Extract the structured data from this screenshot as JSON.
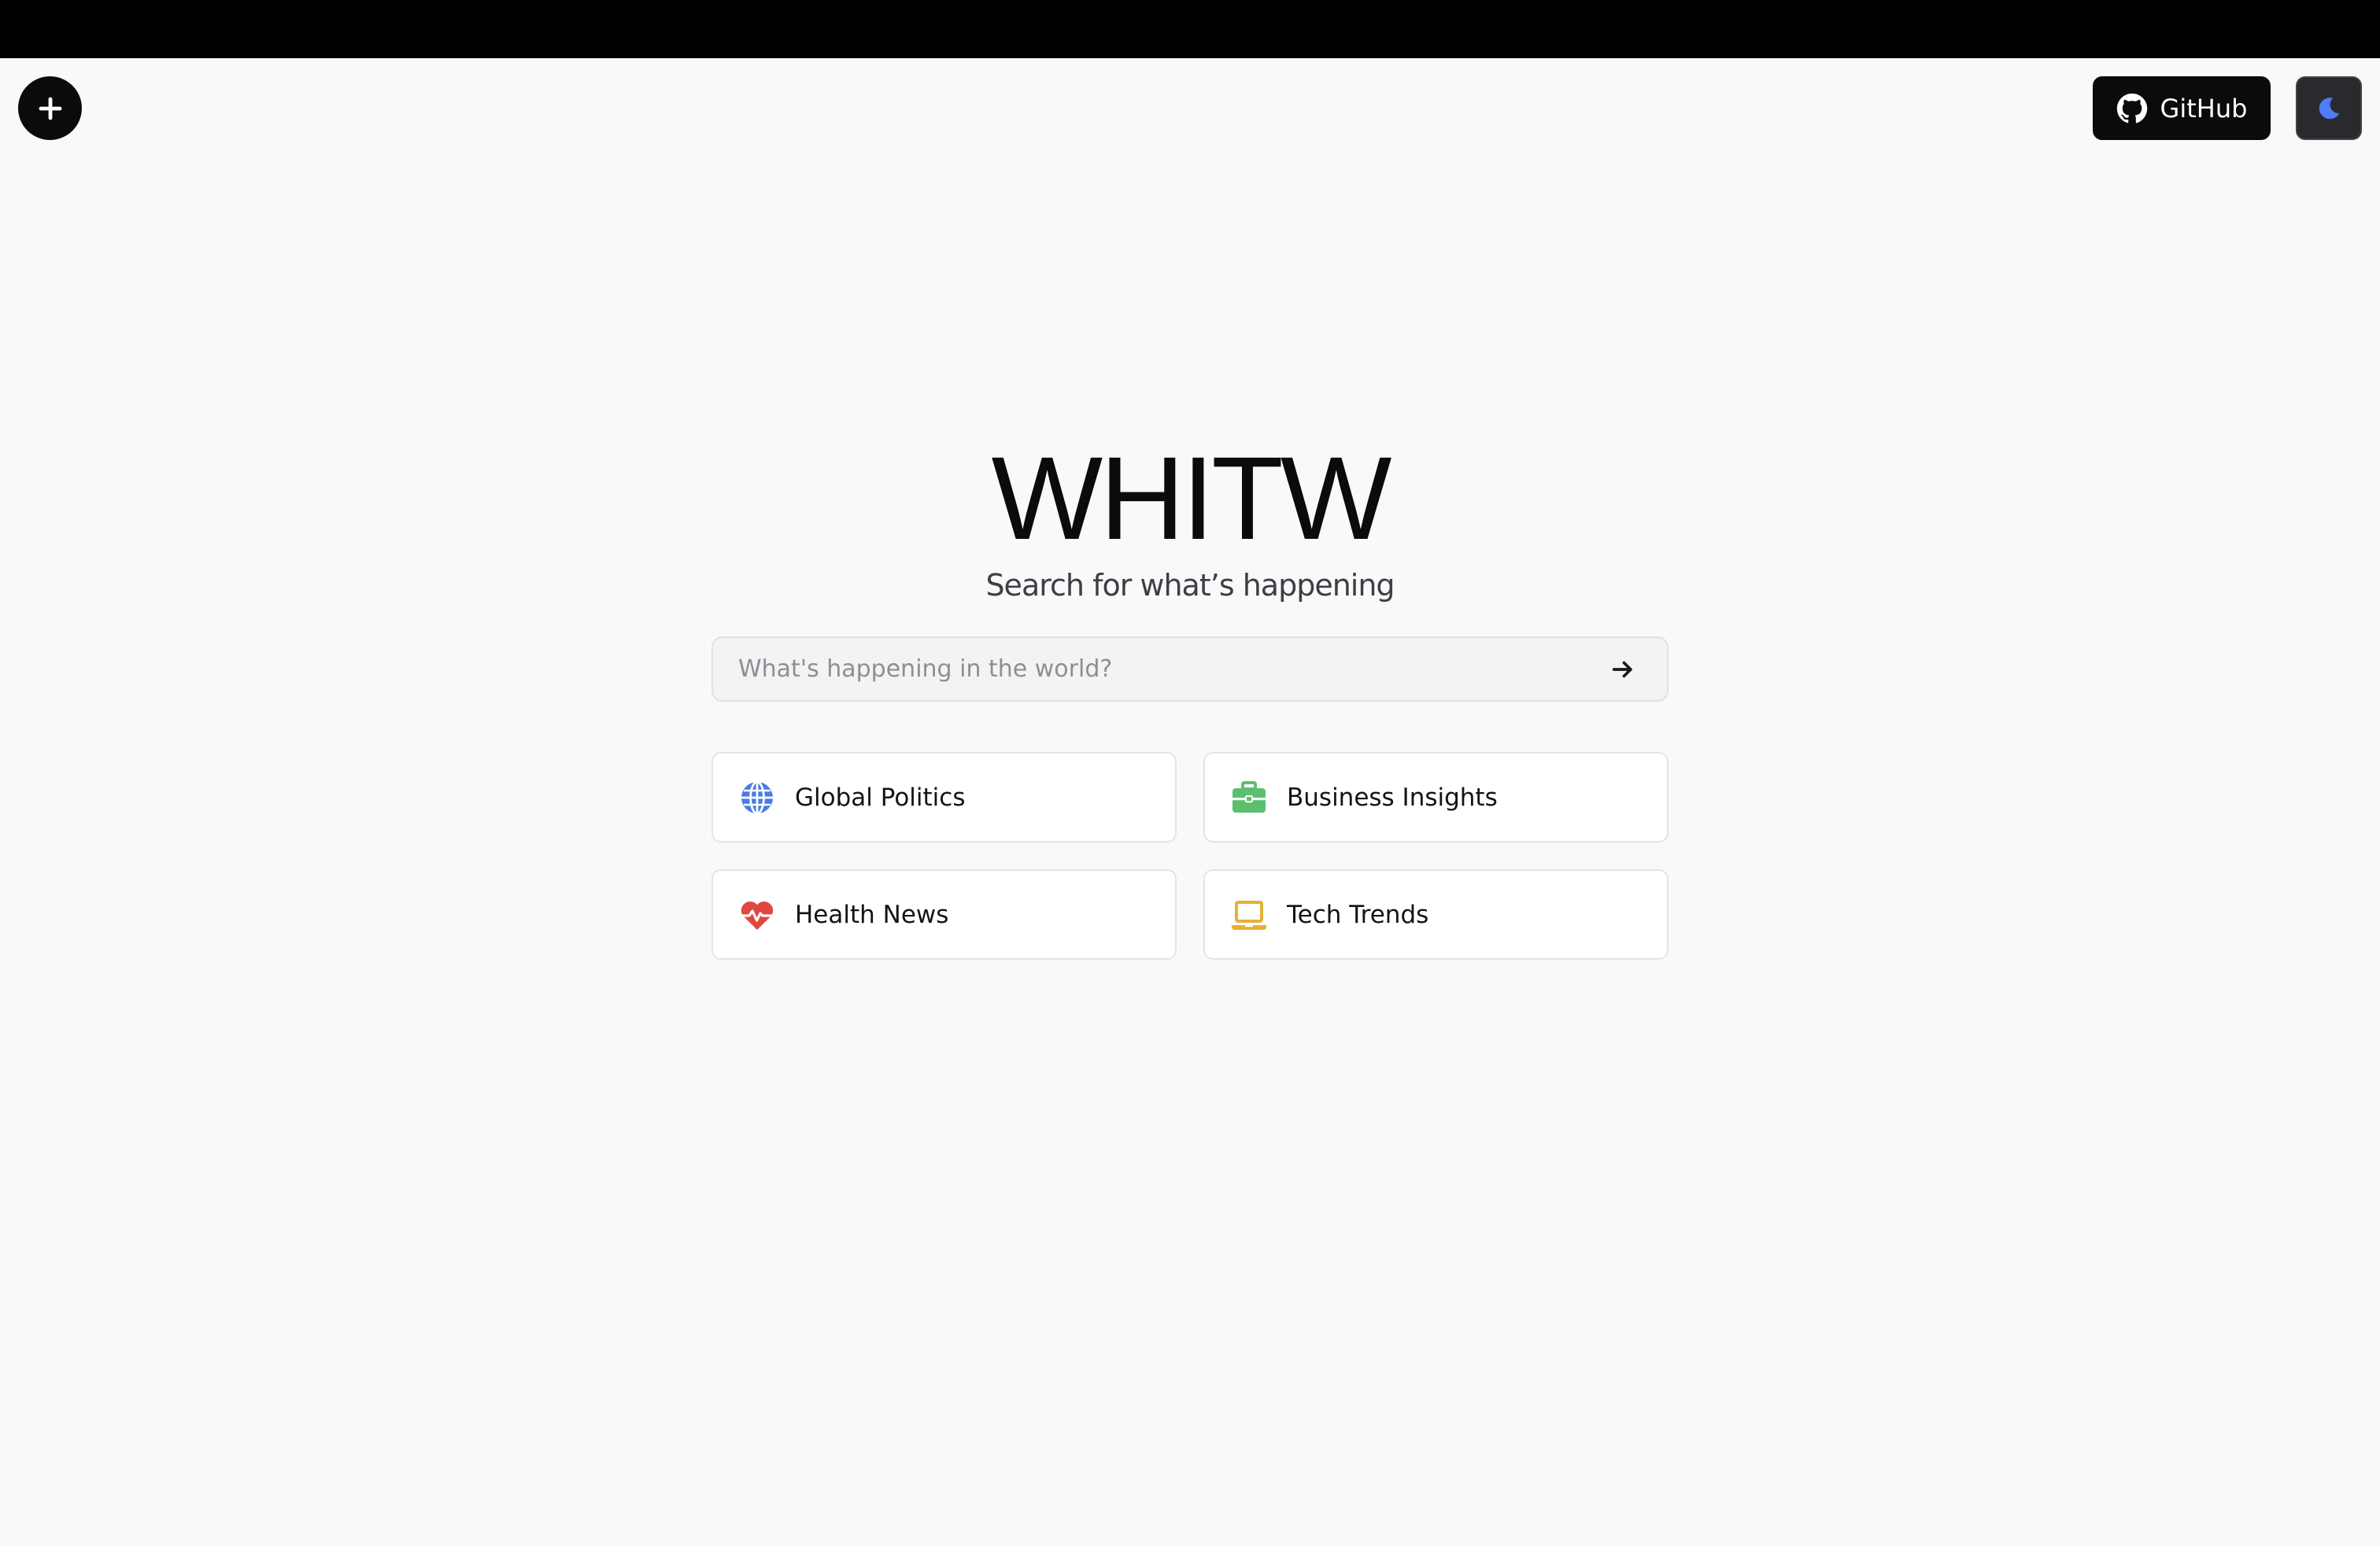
{
  "header": {
    "new_button_icon": "plus-icon",
    "github_label": "GitHub",
    "github_icon": "github-icon",
    "theme_icon": "moon-icon",
    "theme_icon_color": "#4f7cf7"
  },
  "hero": {
    "title": "WHITW",
    "subtitle": "Search for what’s happening"
  },
  "search": {
    "placeholder": "What's happening in the world?",
    "value": "",
    "submit_icon": "arrow-right-icon"
  },
  "topics": [
    {
      "label": "Global Politics",
      "icon": "globe-icon",
      "color": "#4a7be0"
    },
    {
      "label": "Business Insights",
      "icon": "briefcase-icon",
      "color": "#5cbf6e"
    },
    {
      "label": "Health News",
      "icon": "heart-pulse-icon",
      "color": "#e0473f"
    },
    {
      "label": "Tech Trends",
      "icon": "laptop-icon",
      "color": "#e5b137"
    }
  ]
}
